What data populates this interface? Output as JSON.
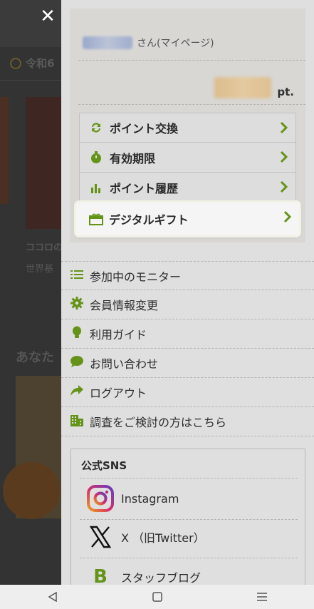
{
  "background": {
    "date_text": "令和6",
    "product_title": "ココロの",
    "product_sub": "世界基",
    "section_title": "あなた"
  },
  "drawer": {
    "user": {
      "suffix": "さん(マイページ)"
    },
    "points": {
      "unit": "pt."
    },
    "point_menu": [
      {
        "label": "ポイント交換",
        "icon": "refresh-icon"
      },
      {
        "label": "有効期限",
        "icon": "stopwatch-icon"
      },
      {
        "label": "ポイント履歴",
        "icon": "bar-chart-icon"
      },
      {
        "label": "デジタルギフト",
        "icon": "gift-card-icon"
      }
    ],
    "nav": [
      {
        "label": "参加中のモニター",
        "icon": "list-icon"
      },
      {
        "label": "会員情報変更",
        "icon": "gear-icon"
      },
      {
        "label": "利用ガイド",
        "icon": "lightbulb-icon"
      },
      {
        "label": "お問い合わせ",
        "icon": "chat-bubble-icon"
      },
      {
        "label": "ログアウト",
        "icon": "share-arrow-icon"
      },
      {
        "label": "調査をご検討の方はこちら",
        "icon": "building-icon"
      }
    ],
    "sns": {
      "title": "公式SNS",
      "items": [
        {
          "label": "Instagram",
          "icon": "instagram-icon"
        },
        {
          "label": "X （旧Twitter）",
          "icon": "x-icon"
        },
        {
          "label": "スタッフブログ",
          "icon": "blog-b-icon"
        }
      ]
    }
  },
  "colors": {
    "accent_green": "#6a9a1a",
    "drawer_bg": "#e9e9e9",
    "overlay": "#333333"
  }
}
